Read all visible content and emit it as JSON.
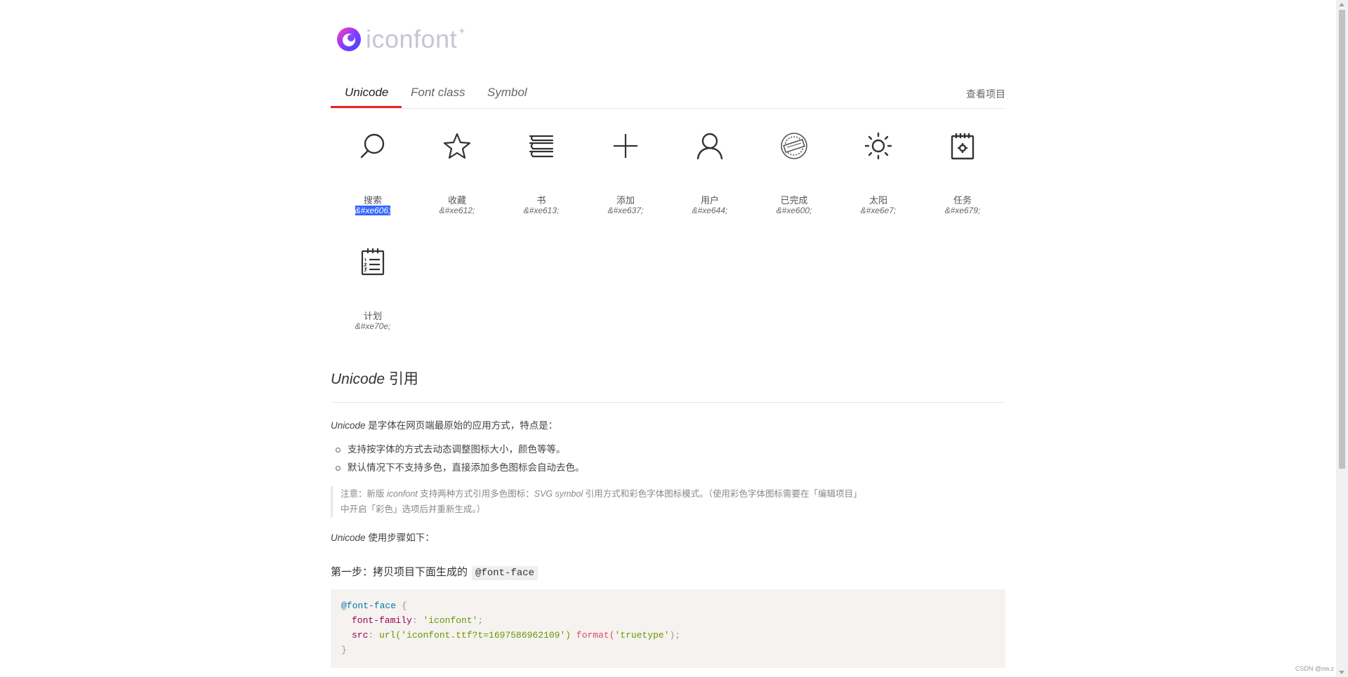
{
  "brand": {
    "name": "iconfont",
    "star": "✦"
  },
  "tabs": [
    {
      "label": "Unicode",
      "active": true
    },
    {
      "label": "Font class",
      "active": false
    },
    {
      "label": "Symbol",
      "active": false
    }
  ],
  "project_link": "查看项目",
  "icons": [
    {
      "icon": "search-icon",
      "name": "搜索",
      "code": "&#xe606;",
      "selected": true
    },
    {
      "icon": "star-icon",
      "name": "收藏",
      "code": "&#xe612;"
    },
    {
      "icon": "book-icon",
      "name": "书",
      "code": "&#xe613;"
    },
    {
      "icon": "plus-icon",
      "name": "添加",
      "code": "&#xe637;"
    },
    {
      "icon": "user-icon",
      "name": "用户",
      "code": "&#xe644;"
    },
    {
      "icon": "completed-stamp-icon",
      "name": "已完成",
      "code": "&#xe600;"
    },
    {
      "icon": "sun-icon",
      "name": "太阳",
      "code": "&#xe6e7;"
    },
    {
      "icon": "task-calendar-icon",
      "name": "任务",
      "code": "&#xe679;"
    },
    {
      "icon": "plan-list-icon",
      "name": "计划",
      "code": "&#xe70e;"
    }
  ],
  "section": {
    "title_italic": "Unicode",
    "title_rest": " 引用",
    "intro_italic": "Unicode",
    "intro_rest": " 是字体在网页端最原始的应用方式，特点是：",
    "bullets": [
      "支持按字体的方式去动态调整图标大小，颜色等等。",
      "默认情况下不支持多色，直接添加多色图标会自动去色。"
    ],
    "note": {
      "p1": "注意：新版 ",
      "i1": "iconfont",
      "p2": " 支持两种方式引用多色图标：",
      "i2": "SVG symbol",
      "p3": " 引用方式和彩色字体图标模式。（使用彩色字体图标需要在「编辑项目」",
      "p4": "中开启「彩色」选项后并重新生成。）"
    },
    "steps_intro_italic": "Unicode",
    "steps_intro_rest": " 使用步骤如下：",
    "step1_text": "第一步：拷贝项目下面生成的",
    "step1_code": "@font-face"
  },
  "code": {
    "l1_at": "@font-face",
    "l1_brace": " {",
    "l2_prop": "font-family",
    "l2_colon": ": ",
    "l2_val": "'iconfont'",
    "l2_end": ";",
    "l3_prop": "src",
    "l3_colon": ": ",
    "l3_url": "url(",
    "l3_str": "'iconfont.ttf?t=1697586962109'",
    "l3_close": ")",
    "l3_fmt": " format(",
    "l3_fmtval": "'truetype'",
    "l3_end": ");",
    "l4": "}"
  },
  "watermark": "CSDN @ow.z"
}
